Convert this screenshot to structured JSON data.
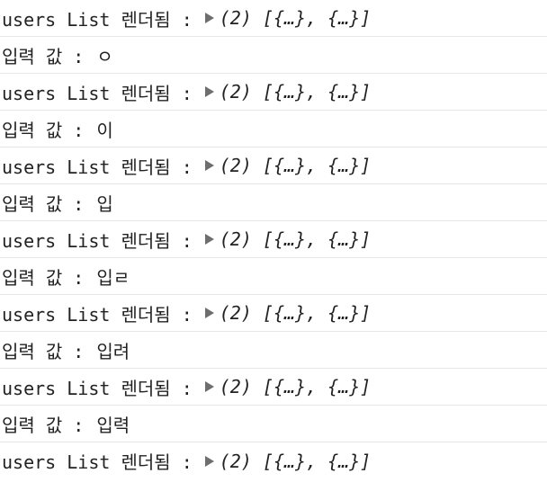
{
  "console": {
    "lines": [
      {
        "type": "log",
        "label": "users List 렌더됨 :",
        "preview": "(2) [{…}, {…}]"
      },
      {
        "type": "input",
        "label": "입력 값 :",
        "value": "ㅇ"
      },
      {
        "type": "log",
        "label": "users List 렌더됨 :",
        "preview": "(2) [{…}, {…}]"
      },
      {
        "type": "input",
        "label": "입력 값 :",
        "value": "이"
      },
      {
        "type": "log",
        "label": "users List 렌더됨 :",
        "preview": "(2) [{…}, {…}]"
      },
      {
        "type": "input",
        "label": "입력 값 :",
        "value": "입"
      },
      {
        "type": "log",
        "label": "users List 렌더됨 :",
        "preview": "(2) [{…}, {…}]"
      },
      {
        "type": "input",
        "label": "입력 값 :",
        "value": "입ㄹ"
      },
      {
        "type": "log",
        "label": "users List 렌더됨 :",
        "preview": "(2) [{…}, {…}]"
      },
      {
        "type": "input",
        "label": "입력 값 :",
        "value": "입려"
      },
      {
        "type": "log",
        "label": "users List 렌더됨 :",
        "preview": "(2) [{…}, {…}]"
      },
      {
        "type": "input",
        "label": "입력 값 :",
        "value": "입력"
      },
      {
        "type": "log",
        "label": "users List 렌더됨 :",
        "preview": "(2) [{…}, {…}]"
      }
    ]
  }
}
